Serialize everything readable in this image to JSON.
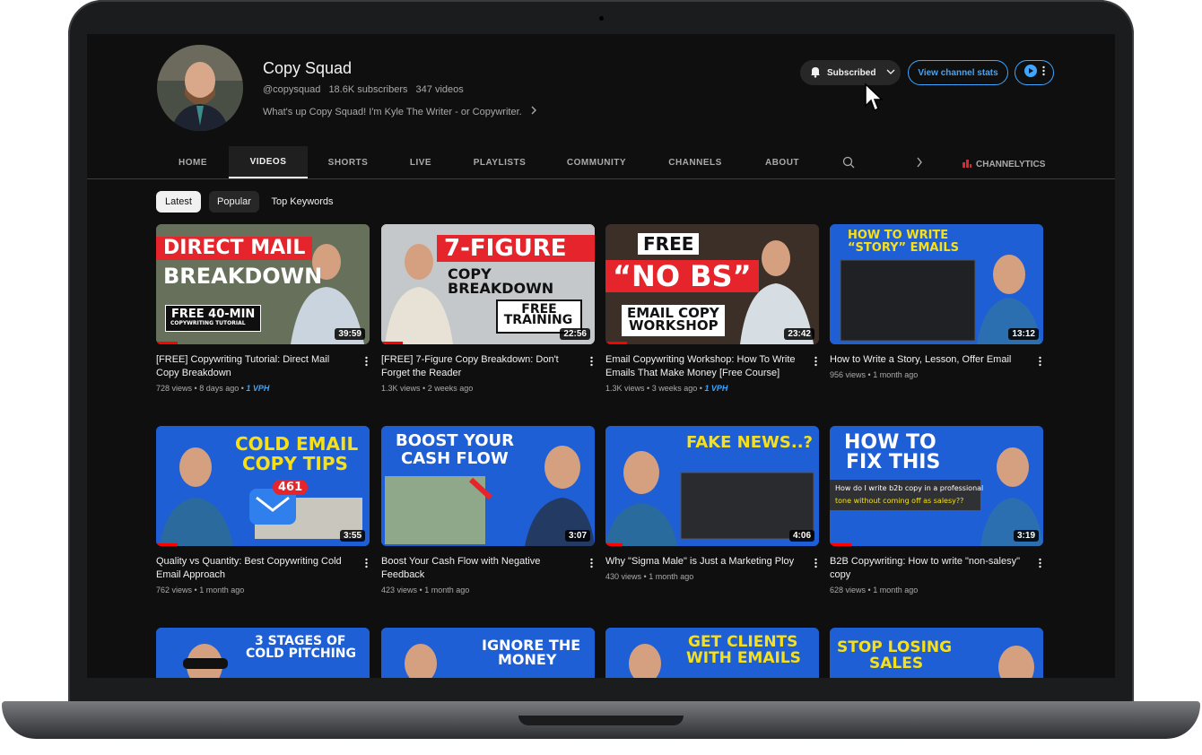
{
  "channel": {
    "name": "Copy Squad",
    "handle": "@copysquad",
    "subscribers": "18.6K subscribers",
    "videos_count": "347 videos",
    "description": "What's up Copy Squad! I'm Kyle The Writer - or Copywriter.",
    "subscribed_label": "Subscribed",
    "stats_label": "View channel stats"
  },
  "tabs": [
    "HOME",
    "VIDEOS",
    "SHORTS",
    "LIVE",
    "PLAYLISTS",
    "COMMUNITY",
    "CHANNELS",
    "ABOUT"
  ],
  "channelytics_label": "CHANNELYTICS",
  "chips": [
    "Latest",
    "Popular",
    "Top Keywords"
  ],
  "videos": [
    {
      "title": "[FREE] Copywriting Tutorial: Direct Mail Copy Breakdown",
      "views": "728 views",
      "age": "8 days ago",
      "vph": "1 VPH",
      "duration": "39:59",
      "progress": 0.1,
      "thumb": {
        "l1": "DIRECT MAIL",
        "l2": "BREAKDOWN",
        "l3": "FREE 40-MIN",
        "l4": "COPYWRITING TUTORIAL"
      }
    },
    {
      "title": "[FREE] 7-Figure Copy Breakdown: Don't Forget the Reader",
      "views": "1.3K views",
      "age": "2 weeks ago",
      "vph": "",
      "duration": "22:56",
      "progress": 0.1,
      "thumb": {
        "l1": "7-FIGURE",
        "l2": "COPY BREAKDOWN",
        "l3": "FREE",
        "l4": "TRAINING"
      }
    },
    {
      "title": "Email Copywriting Workshop: How To Write Emails That Make Money [Free Course]",
      "views": "1.3K views",
      "age": "3 weeks ago",
      "vph": "1 VPH",
      "duration": "23:42",
      "progress": 0.1,
      "thumb": {
        "l1": "FREE",
        "l2": "“NO BS”",
        "l3": "EMAIL COPY",
        "l4": "WORKSHOP"
      }
    },
    {
      "title": "How to Write a Story, Lesson, Offer Email",
      "views": "956 views",
      "age": "1 month ago",
      "vph": "",
      "duration": "13:12",
      "progress": 0,
      "thumb": {
        "l1": "HOW TO WRITE",
        "l2": "“STORY” EMAILS",
        "l3": "",
        "l4": ""
      }
    },
    {
      "title": "Quality vs Quantity: Best Copywriting Cold Email Approach",
      "views": "762 views",
      "age": "1 month ago",
      "vph": "",
      "duration": "3:55",
      "progress": 0.1,
      "thumb": {
        "l1": "COLD EMAIL",
        "l2": "COPY TIPS",
        "l3": "461",
        "l4": ""
      }
    },
    {
      "title": "Boost Your Cash Flow with Negative Feedback",
      "views": "423 views",
      "age": "1 month ago",
      "vph": "",
      "duration": "3:07",
      "progress": 0,
      "thumb": {
        "l1": "BOOST YOUR",
        "l2": "CASH FLOW",
        "l3": "",
        "l4": ""
      }
    },
    {
      "title": "Why \"Sigma Male\" is Just a Marketing Ploy",
      "views": "430 views",
      "age": "1 month ago",
      "vph": "",
      "duration": "4:06",
      "progress": 0.08,
      "thumb": {
        "l1": "FAKE NEWS..?",
        "l2": "",
        "l3": "",
        "l4": ""
      }
    },
    {
      "title": "B2B Copywriting: How to write \"non-salesy\" copy",
      "views": "628 views",
      "age": "1 month ago",
      "vph": "",
      "duration": "3:19",
      "progress": 0.1,
      "thumb": {
        "l1": "HOW TO",
        "l2": "FIX THIS",
        "l3": "How do I write b2b copy in a professional",
        "l4": "tone without coming off as salesy??"
      }
    },
    {
      "title": "",
      "views": "",
      "age": "",
      "vph": "",
      "duration": "",
      "progress": 0,
      "thumb": {
        "l1": "3 STAGES OF",
        "l2": "COLD PITCHING",
        "l3": "",
        "l4": ""
      }
    },
    {
      "title": "",
      "views": "",
      "age": "",
      "vph": "",
      "duration": "",
      "progress": 0,
      "thumb": {
        "l1": "IGNORE THE",
        "l2": "MONEY",
        "l3": "",
        "l4": ""
      }
    },
    {
      "title": "",
      "views": "",
      "age": "",
      "vph": "",
      "duration": "",
      "progress": 0,
      "thumb": {
        "l1": "GET CLIENTS",
        "l2": "WITH EMAILS",
        "l3": "",
        "l4": ""
      }
    },
    {
      "title": "",
      "views": "",
      "age": "",
      "vph": "",
      "duration": "",
      "progress": 0,
      "thumb": {
        "l1": "STOP LOSING",
        "l2": "SALES",
        "l3": "",
        "l4": ""
      }
    }
  ],
  "colors": {
    "bg": "#0f0f0f",
    "accent": "#3ea6ff",
    "red": "#ff0000",
    "thumb_red": "#e5242b",
    "thumb_blue": "#1f5fd6",
    "thumb_yellow": "#f7e017"
  }
}
